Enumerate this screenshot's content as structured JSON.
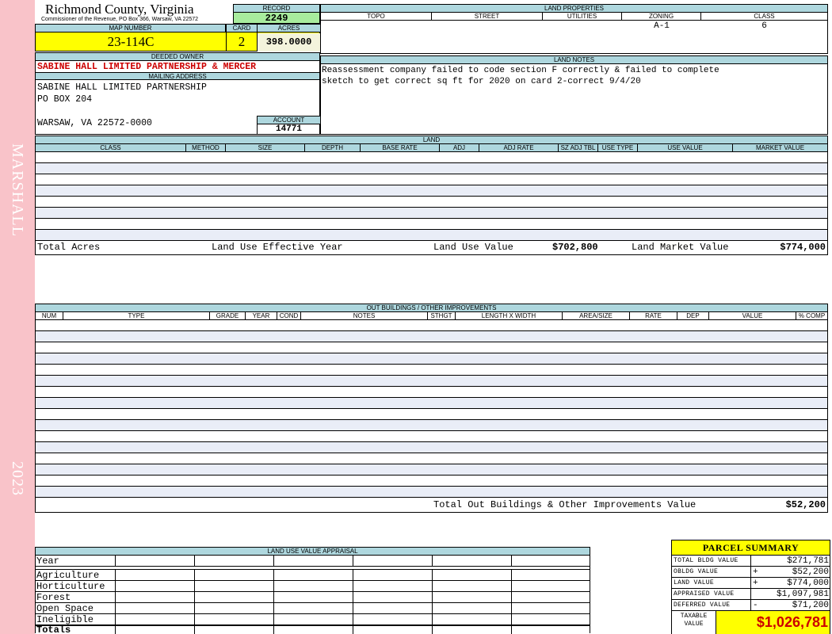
{
  "side": {
    "district": "MARSHALL",
    "year": "2023"
  },
  "header": {
    "county": "Richmond County, Virginia",
    "commissioner": "Commissioner of the Revenue, PO Box 366, Warsaw, VA 22572",
    "record_label": "RECORD",
    "record": "2249",
    "map_label": "MAP NUMBER",
    "map_number": "23-114C",
    "card_label": "CARD",
    "card": "2",
    "acres_label": "ACRES",
    "acres": "398.0000"
  },
  "owner": {
    "deeded_label": "DEEDED OWNER",
    "deeded_owner": "SABINE HALL LIMITED PARTNERSHIP & MERCER",
    "mailing_label": "MAILING ADDRESS",
    "mailing_lines": [
      "SABINE HALL LIMITED PARTNERSHIP",
      "PO BOX 204",
      "",
      "WARSAW, VA 22572-0000"
    ],
    "account_label": "ACCOUNT",
    "account": "14771"
  },
  "land_properties": {
    "label": "LAND PROPERTIES",
    "headers": [
      "TOPO",
      "STREET",
      "UTILITIES",
      "ZONING",
      "CLASS"
    ],
    "zoning": "A-1",
    "class": "6"
  },
  "land_notes": {
    "label": "LAND NOTES",
    "lines": [
      "Reassessment company failed to code section F correctly & failed to complete",
      "sketch to get correct sq ft for 2020 on card 2-correct 9/4/20"
    ]
  },
  "land": {
    "label": "LAND",
    "headers": [
      "CLASS",
      "METHOD",
      "SIZE",
      "DEPTH",
      "BASE RATE",
      "ADJ",
      "ADJ RATE",
      "SZ ADJ TBL",
      "USE TYPE",
      "USE VALUE",
      "MARKET VALUE"
    ],
    "total_acres_label": "Total Acres",
    "land_use_year_label": "Land Use Effective Year",
    "land_use_value_label": "Land Use Value",
    "land_use_value": "$702,800",
    "land_market_value_label": "Land Market Value",
    "land_market_value": "$774,000"
  },
  "outbuildings": {
    "label": "OUT BUILDINGS / OTHER IMPROVEMENTS",
    "headers": [
      "NUM",
      "TYPE",
      "GRADE",
      "YEAR",
      "COND",
      "NOTES",
      "STHGT",
      "LENGTH X WIDTH",
      "AREA/SIZE",
      "RATE",
      "DEP",
      "VALUE",
      "% COMP"
    ],
    "total_label": "Total Out Buildings & Other Improvements Value",
    "total": "$52,200"
  },
  "land_use_appraisal": {
    "label": "LAND USE VALUE APPRAISAL",
    "rows": [
      "Year",
      "Agriculture",
      "Horticulture",
      "Forest",
      "Open Space",
      "Ineligible",
      "Totals"
    ]
  },
  "parcel_summary": {
    "title": "PARCEL SUMMARY",
    "rows": [
      {
        "name": "TOTAL BLDG VALUE",
        "sign": "",
        "value": "$271,781"
      },
      {
        "name": "OBLDG VALUE",
        "sign": "+",
        "value": "$52,200"
      },
      {
        "name": "LAND VALUE",
        "sign": "+",
        "value": "$774,000"
      },
      {
        "name": "APPRAISED VALUE",
        "sign": "",
        "value": "$1,097,981"
      },
      {
        "name": "DEFERRED VALUE",
        "sign": "-",
        "value": "$71,200"
      }
    ],
    "taxable_label": "TAXABLE VALUE",
    "taxable_value": "$1,026,781"
  },
  "colors": {
    "header_blue": "#aed7de",
    "yellow": "#ffff00",
    "green": "#a8ec9d",
    "pink": "#f9c3c9",
    "red": "#cc0000"
  }
}
